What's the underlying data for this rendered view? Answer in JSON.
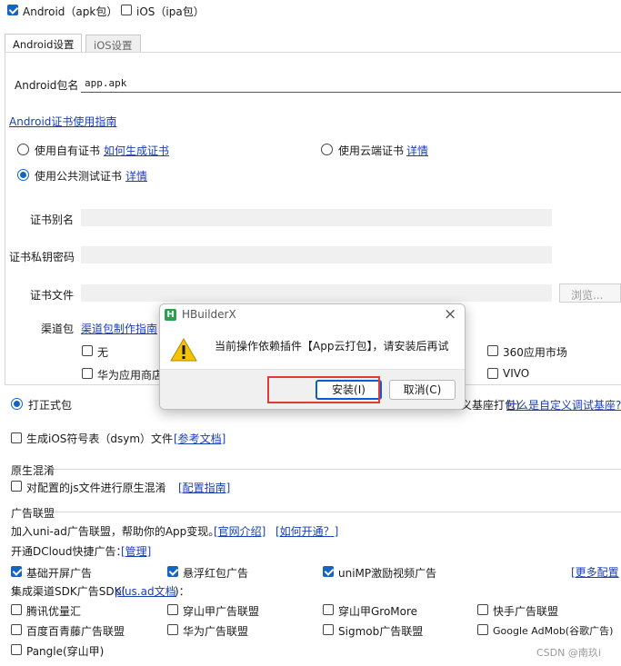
{
  "top_options": {
    "android_label": "Android（apk包）",
    "ios_label": "iOS（ipa包）"
  },
  "tabs": [
    "Android设置",
    "iOS设置"
  ],
  "package": {
    "label": "Android包名",
    "value": "app.apk"
  },
  "cert_guide_link": "Android证书使用指南",
  "cert_options": {
    "own_label": "使用自有证书",
    "own_link": "如何生成证书",
    "cloud_label": "使用云端证书",
    "cloud_link": "详情",
    "public_label": "使用公共测试证书",
    "public_link": "详情"
  },
  "cert_fields": {
    "alias_label": "证书别名",
    "password_label": "证书私钥密码",
    "file_label": "证书文件",
    "browse_button": "浏览..."
  },
  "channel": {
    "label": "渠道包",
    "link": "渠道包制作指南",
    "none": "无",
    "huawei": "华为应用商店",
    "m360": "360应用市场",
    "vivo": "VIVO"
  },
  "build_type": {
    "formal": "打正式包",
    "custom_tail": "义基座打包)",
    "custom_link": "什么是自定义调试基座?"
  },
  "dsym": {
    "label": "生成iOS符号表（dsym）文件",
    "link": "[参考文档]"
  },
  "obfuscation": {
    "section_title": "原生混淆",
    "label": "对配置的js文件进行原生混淆",
    "link": "[配置指南]"
  },
  "ads": {
    "section_title": "广告联盟",
    "join_text": "加入uni-ad广告联盟，帮助你的App变现。",
    "intro_link": "[官网介绍]",
    "how_link": "[如何开通？]",
    "quick_text": "开通DCloud快捷广告：",
    "manage_link": "[管理]",
    "splash": "基础开屏广告",
    "float_red": "悬浮红包广告",
    "reward_video": "uniMP激励视频广告",
    "more_link": "[更多配置",
    "sdk_text_prefix": "集成渠道SDK广告SDK(",
    "sdk_link": "plus.ad文档",
    "sdk_text_suffix": ")：",
    "tencent": "腾讯优量汇",
    "pangle_cn": "穿山甲广告联盟",
    "gromore": "穿山甲GroMore",
    "kuaishou": "快手广告联盟",
    "baidu": "百度百青藤广告联盟",
    "huawei_ads": "华为广告联盟",
    "sigmob": "Sigmob广告联盟",
    "admob": "Google AdMob(谷歌广告)",
    "pangle": "Pangle(穿山甲)"
  },
  "dialog": {
    "title": "HBuilderX",
    "logo_letter": "H",
    "message": "当前操作依赖插件【App云打包】，请安装后再试",
    "install_button": "安装(I)",
    "cancel_button": "取消(C)",
    "close_glyph": "×",
    "warning_glyph": "!"
  },
  "watermark": "CSDN @南玖i",
  "colors": {
    "accent": "#1565c0",
    "link": "#1a3fb5",
    "highlight": "#e53935",
    "logo": "#2e9e4f"
  }
}
